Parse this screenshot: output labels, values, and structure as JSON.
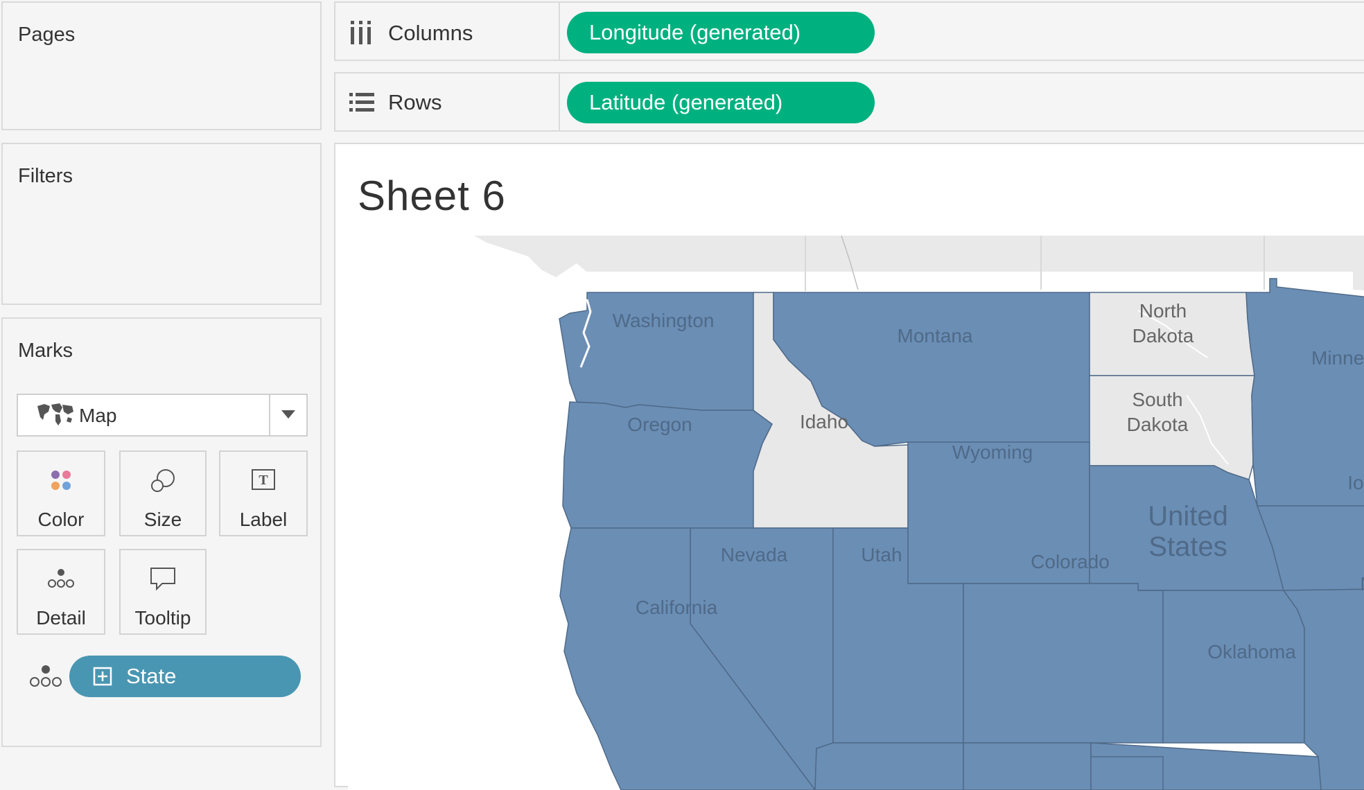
{
  "pages_panel": {
    "title": "Pages"
  },
  "filters_panel": {
    "title": "Filters"
  },
  "marks_panel": {
    "title": "Marks",
    "mark_type": "Map",
    "buttons": {
      "color": "Color",
      "size": "Size",
      "label": "Label",
      "detail": "Detail",
      "tooltip": "Tooltip"
    },
    "fields": [
      {
        "name": "State",
        "icon": "detail-icon"
      }
    ]
  },
  "shelves": {
    "columns": {
      "label": "Columns",
      "pill": "Longitude (generated)",
      "icon": "columns-icon"
    },
    "rows": {
      "label": "Rows",
      "pill": "Latitude (generated)",
      "icon": "rows-icon"
    }
  },
  "sheet": {
    "title": "Sheet 6"
  },
  "map": {
    "selected_color": "#6b8eb5",
    "unselected_color": "#e8e8e8",
    "state_labels": {
      "washington": "Washington",
      "montana": "Montana",
      "north_dakota": [
        "North",
        "Dakota"
      ],
      "minnesota": "Minnes",
      "oregon": "Oregon",
      "idaho": "Idaho",
      "south_dakota": [
        "South",
        "Dakota"
      ],
      "wyoming": "Wyoming",
      "iowa": "Iow",
      "country": [
        "United",
        "States"
      ],
      "nevada": "Nevada",
      "utah": "Utah",
      "colorado": "Colorado",
      "missouri": "M",
      "california": "California",
      "oklahoma": "Oklahoma"
    }
  },
  "colors": {
    "pill_green": "#00b180",
    "pill_blue": "#4996b2",
    "state_blue": "#6b8eb5"
  }
}
